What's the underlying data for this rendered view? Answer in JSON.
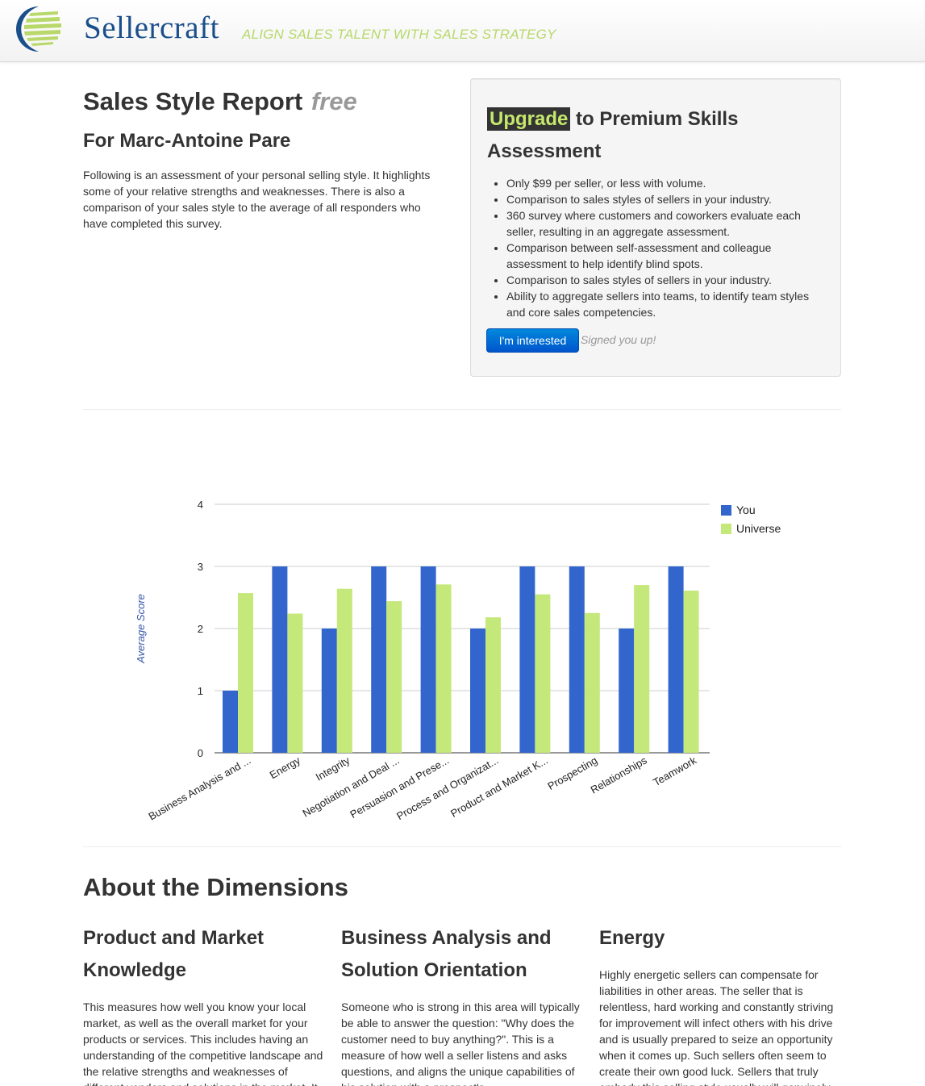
{
  "header": {
    "brand": "Sellercraft",
    "tagline": "ALIGN SALES TALENT WITH SALES STRATEGY",
    "logo_icon": "sellercraft-logo-icon",
    "colors": {
      "brand": "#1a4f8b",
      "tagline": "#b7d96b",
      "logo_green": "#b9d86a",
      "logo_blue": "#1a4f8b"
    }
  },
  "report": {
    "title": "Sales Style Report",
    "title_tag": "free",
    "for_line": "For Marc-Antoine Pare",
    "intro": "Following is an assessment of your personal selling style. It highlights some of your relative strengths and weaknesses. There is also a comparison of your sales style to the average of all responders who have completed this survey."
  },
  "upgrade": {
    "highlight": "Upgrade",
    "heading_rest": "to Premium Skills Assessment",
    "bullets": [
      "Only $99 per seller, or less with volume.",
      "Comparison to sales styles of sellers in your industry.",
      "360 survey where customers and coworkers evaluate each seller, resulting in an aggregate assessment.",
      "Comparison between self-assessment and colleague assessment to help identify blind spots.",
      "Comparison to sales styles of sellers in your industry.",
      "Ability to aggregate sellers into teams, to identify team styles and core sales competencies."
    ],
    "button_label": "I'm interested",
    "status": "Signed you up!"
  },
  "chart_data": {
    "type": "bar",
    "title": "",
    "xlabel": "",
    "ylabel": "Average Score",
    "ylim": [
      0,
      4
    ],
    "yticks": [
      "0",
      "1",
      "2",
      "3",
      "4"
    ],
    "grid": true,
    "legend_position": "right",
    "categories": [
      "Business Analysis and ...",
      "Energy",
      "Integrity",
      "Negotiation and Deal ...",
      "Persuasion and Prese...",
      "Process and Organizat...",
      "Product and Market K...",
      "Prospecting",
      "Relationships",
      "Teamwork"
    ],
    "series": [
      {
        "name": "You",
        "color": "#3366cc",
        "values": [
          1,
          3,
          2,
          3,
          3,
          2,
          3,
          3,
          2,
          3
        ]
      },
      {
        "name": "Universe",
        "color": "#c5e87a",
        "values": [
          2.57,
          2.24,
          2.64,
          2.44,
          2.71,
          2.18,
          2.55,
          2.25,
          2.7,
          2.61
        ]
      }
    ]
  },
  "dimensions": {
    "title": "About the Dimensions",
    "items": [
      {
        "title": "Product and Market Knowledge",
        "text": "This measures how well you know your local market, as well as the overall market for your products or services. This includes having an understanding of the competitive landscape and the relative strengths and weaknesses of different vendors and solutions in the market. It"
      },
      {
        "title": "Business Analysis and Solution Orientation",
        "text": "Someone who is strong in this area will typically be able to answer the question: \"Why does the customer need to buy anything?\". This is a measure of how well a seller listens and asks questions, and aligns the unique capabilities of his solution with a prospect's"
      },
      {
        "title": "Energy",
        "text": "Highly energetic sellers can compensate for liabilities in other areas. The seller that is relentless, hard working and constantly striving for improvement will infect others with his drive and is usually prepared to seize an opportunity when it comes up. Such sellers often seem to create their own good luck. Sellers that truly embody this selling style usually will genuinely"
      }
    ]
  }
}
